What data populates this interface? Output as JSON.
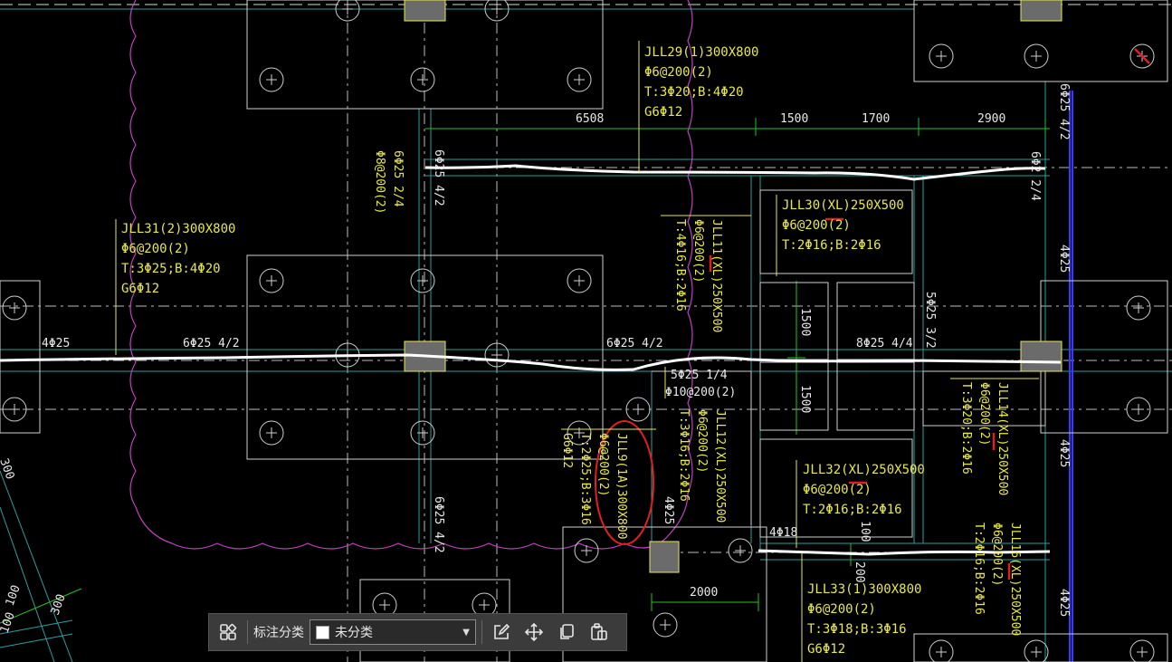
{
  "drawing": {
    "colors": {
      "background": "#000000",
      "beam_text": "#e8e84a",
      "dimension_line": "#22c422",
      "axis_line": "#00c0c0",
      "cloud_revision": "#c040c0",
      "mark_red": "#e02020",
      "outline_white": "#d8d8d8",
      "column_fill": "#6b6b6b",
      "axis_blue": "#3a3aff"
    },
    "beam_notes": [
      {
        "id": "jll29",
        "lines": [
          "JLL29(1)300X800",
          "Φ6@200(2)",
          "T:3Φ20;B:4Φ20",
          "G6Φ12"
        ]
      },
      {
        "id": "jll31",
        "lines": [
          "JLL31(2)300X800",
          "Φ6@200(2)",
          "T:3Φ25;B:4Φ20",
          "G6Φ12"
        ]
      },
      {
        "id": "jll30",
        "lines": [
          "JLL30(XL)250X500",
          "Φ6@200(2)",
          "T:2Φ16;B:2Φ16"
        ]
      },
      {
        "id": "jll32",
        "lines": [
          "JLL32(XL)250X500",
          "Φ6@200(2)",
          "T:2Φ16;B:2Φ16"
        ]
      },
      {
        "id": "jll33",
        "lines": [
          "JLL33(1)300X800",
          "Φ6@200(2)",
          "T:3Φ18;B:3Φ16",
          "G6Φ12"
        ]
      }
    ],
    "vertical_notes": [
      {
        "id": "jll11",
        "lines": [
          "JLL11(XL)250X500",
          "Φ6@200(2)",
          "T:4Φ16;B:2Φ16"
        ]
      },
      {
        "id": "jll12",
        "lines": [
          "JLL12(XL)250X500",
          "Φ6@200(2)",
          "T:3Φ16;B:2Φ16"
        ]
      },
      {
        "id": "jll9",
        "lines": [
          "JLL9(1A)300X800",
          "Φ6@200(2)",
          "T:2Φ25;B:3Φ16",
          "G6Φ12"
        ]
      },
      {
        "id": "jll14",
        "lines": [
          "JLL14(XL)250X500",
          "Φ6@200(2)",
          "T:3Φ20;B:2Φ16"
        ]
      },
      {
        "id": "jll16",
        "lines": [
          "JLL16(XL)250X500",
          "Φ6@200(2)",
          "T:2Φ16;B:2Φ16"
        ]
      },
      {
        "id": "left_top",
        "lines": [
          "6Φ25 2/4",
          "Φ8@200(2)"
        ]
      }
    ],
    "rebar_labels": {
      "l_4phi25": "4Φ25",
      "l_6phi25_42_a": "6Φ25 4/2",
      "l_6phi25_42_b": "6Φ25 4/2",
      "l_8phi25_44": "8Φ25 4/4",
      "l_5phi25_14": "5Φ25 1/4",
      "l_phi10": "Φ10@200(2)",
      "l_4phi18": "4Φ18",
      "v_6phi25_42": "6Φ25 4/2",
      "v_6phi25_42_b": "6Φ25 4/2",
      "v_6phi2_24": "6Φ2 2/4",
      "v_5phi25_32": "5Φ25 3/2",
      "v_4phi25": "4Φ25",
      "v_6phi25_42_r": "6Φ25 4/2",
      "v_4phi25_r1": "4Φ25",
      "v_4phi25_r2": "4Φ25",
      "v_4phi25_r3": "4Φ25",
      "v_4phi25_r4": "4Φ25"
    },
    "dimensions": {
      "d6508": "6508",
      "d1500": "1500",
      "d1700": "1700",
      "d2900": "2900",
      "d1500_v1": "1500",
      "d1500_v2": "1500",
      "d2000": "2000",
      "d100_v": "100",
      "d200_v": "200",
      "d100_l": "100",
      "d300_l": "300",
      "d100_l2": "100",
      "d300_top": "300"
    }
  },
  "toolbar": {
    "category_label": "标注分类",
    "selected_category": "未分类",
    "buttons": [
      "grid-icon",
      "edit-icon",
      "move-icon",
      "copy-icon",
      "paste-icon"
    ]
  }
}
